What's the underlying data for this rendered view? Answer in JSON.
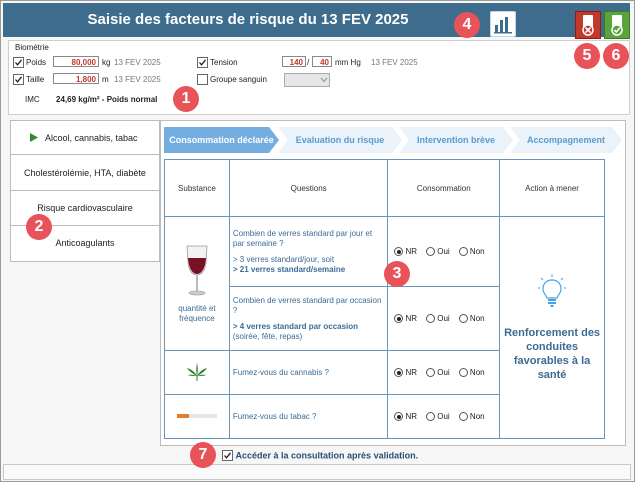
{
  "window": {
    "title": "Saisie des facteurs de risque du 13 FEV 2025"
  },
  "markers": [
    "1",
    "2",
    "3",
    "4",
    "5",
    "6",
    "7"
  ],
  "colors": {
    "titlebar": "#3d6c8c",
    "accent_red": "#c0392b",
    "accent_green": "#5aa43b",
    "link_blue": "#3c6b95",
    "marker": "#e8535a"
  },
  "icons": {
    "chart": "bar-chart-icon",
    "cancel": "cancel-icon",
    "validate": "validate-icon",
    "wine": "wine-glass-icon",
    "cannabis": "cannabis-leaf-icon",
    "cigarette": "cigarette-icon",
    "bulb": "lightbulb-icon"
  },
  "biometrie": {
    "heading": "Biométrie",
    "poids": {
      "label": "Poids",
      "value": "80,000",
      "unit": "kg",
      "date": "13 FEV 2025"
    },
    "taille": {
      "label": "Taille",
      "value": "1,800",
      "unit": "m",
      "date": "13 FEV 2025"
    },
    "tension": {
      "label": "Tension",
      "sys": "140",
      "sep": "/",
      "dia": "40",
      "unit": "mm Hg",
      "date": "13 FEV 2025"
    },
    "groupe": {
      "label": "Groupe sanguin"
    },
    "imc": {
      "label": "IMC",
      "value": "24,69 kg/m² - Poids normal"
    }
  },
  "nav": {
    "items": [
      {
        "label": "Alcool, cannabis, tabac"
      },
      {
        "label": "Cholestérolémie, HTA, diabète"
      },
      {
        "label": "Risque cardiovasculaire"
      },
      {
        "label": "Anticoagulants"
      }
    ]
  },
  "steps": [
    "Consommation déclarée",
    "Evaluation du risque",
    "Intervention brève",
    "Accompagnement"
  ],
  "table": {
    "headers": [
      "Substance",
      "Questions",
      "Consommation",
      "Action à mener"
    ],
    "substance_label": "quantité et fréquence",
    "options": [
      "NR",
      "Oui",
      "Non"
    ],
    "rows": [
      {
        "q": "Combien de verres standard par jour et par semaine ?",
        "a1": "> 3 verres standard/jour, soit",
        "a2": "> 21 verres standard/semaine"
      },
      {
        "q": "Combien de verres standard par occasion ?",
        "a2": "> 4 verres standard par occasion",
        "a3": "(soirée, fête, repas)"
      },
      {
        "q": "Fumez-vous du cannabis ?"
      },
      {
        "q": "Fumez-vous du tabac ?"
      }
    ],
    "action": "Renforcement des conduites favorables à la santé"
  },
  "footer": {
    "checkbox_label": "Accéder à la consultation après validation."
  }
}
